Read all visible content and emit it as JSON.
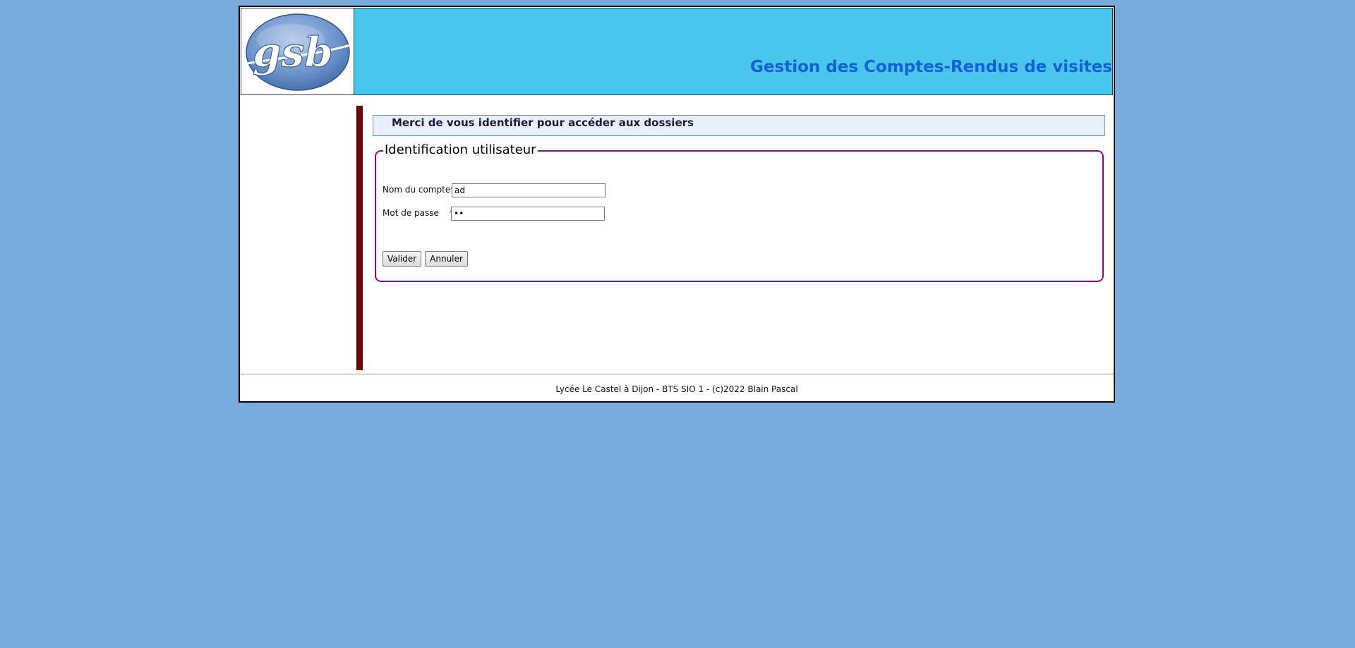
{
  "header": {
    "logo_text": "gsb",
    "title": "Gestion des Comptes-Rendus de visites"
  },
  "notice": {
    "text": "Merci de vous identifier pour accéder aux dossiers"
  },
  "form": {
    "legend": "Identification utilisateur",
    "account_label": "Nom du compte*",
    "account_value": "ad",
    "password_label": "Mot de passe    *",
    "password_value": "ad",
    "submit_label": "Valider",
    "cancel_label": "Annuler"
  },
  "footer": {
    "text": "Lycée Le Castel à Dijon - BTS SIO 1 - (c)2022 Blain Pascal"
  },
  "colors": {
    "page_background": "#79abdd",
    "header_background": "#4ac5ee",
    "title_color": "#1460d8",
    "sidebar_bar": "#6e0000",
    "fieldset_border": "#8a0a8e",
    "notice_background": "#e7f1fc"
  },
  "icons": {
    "logo": "gsb-logo"
  }
}
